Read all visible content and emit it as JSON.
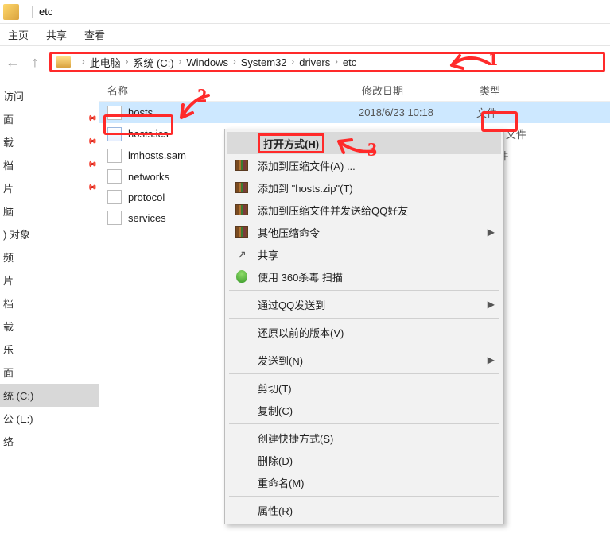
{
  "titlebar": {
    "title": "etc"
  },
  "ribbon": {
    "tabs": [
      "主页",
      "共享",
      "查看"
    ]
  },
  "breadcrumb": {
    "segments": [
      "此电脑",
      "系统 (C:)",
      "Windows",
      "System32",
      "drivers",
      "etc"
    ]
  },
  "columns": {
    "name": "名称",
    "date": "修改日期",
    "type": "类型"
  },
  "sidebar": {
    "items": [
      {
        "label": "访问",
        "pinned": false
      },
      {
        "label": "面",
        "pinned": true
      },
      {
        "label": "载",
        "pinned": true
      },
      {
        "label": "档",
        "pinned": true
      },
      {
        "label": "片",
        "pinned": true
      },
      {
        "label": "脑",
        "pinned": false
      },
      {
        "label": ") 对象",
        "pinned": false
      },
      {
        "label": "频",
        "pinned": false
      },
      {
        "label": "片",
        "pinned": false
      },
      {
        "label": "档",
        "pinned": false
      },
      {
        "label": "载",
        "pinned": false
      },
      {
        "label": "乐",
        "pinned": false
      },
      {
        "label": "面",
        "pinned": false
      },
      {
        "label": "统 (C:)",
        "pinned": false,
        "active": true
      },
      {
        "label": "公 (E:)",
        "pinned": false
      },
      {
        "label": "络",
        "pinned": false
      }
    ]
  },
  "files": [
    {
      "name": "hosts",
      "date": "2018/6/23 10:18",
      "type": "文件",
      "selected": true,
      "icon": "doc"
    },
    {
      "name": "hosts.ics",
      "date": "",
      "type": "endar 文件",
      "icon": "cal"
    },
    {
      "name": "lmhosts.sam",
      "date": "",
      "type": "M 文件",
      "icon": "doc"
    },
    {
      "name": "networks",
      "date": "",
      "type": "",
      "icon": "doc"
    },
    {
      "name": "protocol",
      "date": "",
      "type": "",
      "icon": "doc"
    },
    {
      "name": "services",
      "date": "",
      "type": "",
      "icon": "doc"
    }
  ],
  "contextMenu": {
    "items": [
      {
        "label": "打开方式(H)",
        "icon": "",
        "hover": true,
        "strong": true
      },
      {
        "label": "添加到压缩文件(A) ...",
        "icon": "books"
      },
      {
        "label": "添加到 \"hosts.zip\"(T)",
        "icon": "books"
      },
      {
        "label": "添加到压缩文件并发送给QQ好友",
        "icon": "books"
      },
      {
        "label": "其他压缩命令",
        "icon": "books",
        "sub": true
      },
      {
        "label": "共享",
        "icon": "share"
      },
      {
        "label": "使用 360杀毒 扫描",
        "icon": "shield"
      },
      {
        "sep": true
      },
      {
        "label": "通过QQ发送到",
        "sub": true
      },
      {
        "sep": true
      },
      {
        "label": "还原以前的版本(V)"
      },
      {
        "sep": true
      },
      {
        "label": "发送到(N)",
        "sub": true
      },
      {
        "sep": true
      },
      {
        "label": "剪切(T)"
      },
      {
        "label": "复制(C)"
      },
      {
        "sep": true
      },
      {
        "label": "创建快捷方式(S)"
      },
      {
        "label": "删除(D)"
      },
      {
        "label": "重命名(M)"
      },
      {
        "sep": true
      },
      {
        "label": "属性(R)"
      }
    ]
  },
  "annotations": {
    "n1": "1",
    "n2": "2",
    "n3": "3"
  }
}
